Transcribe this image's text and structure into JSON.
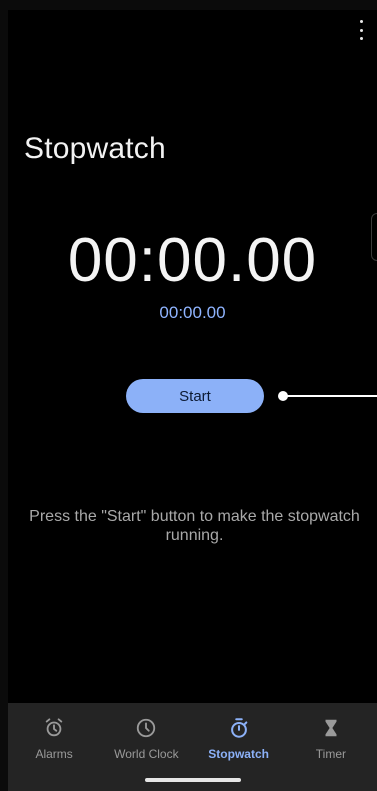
{
  "header": {
    "menu_icon": "more-vert-icon",
    "title": "Stopwatch"
  },
  "stopwatch": {
    "main_time": "00:00.00",
    "lap_time": "00:00.00",
    "start_label": "Start",
    "hint": "Press the \"Start\" button to make the stopwatch running."
  },
  "nav": {
    "items": [
      {
        "label": "Alarms",
        "icon": "alarm-icon",
        "active": false
      },
      {
        "label": "World Clock",
        "icon": "clock-icon",
        "active": false
      },
      {
        "label": "Stopwatch",
        "icon": "stopwatch-icon",
        "active": true
      },
      {
        "label": "Timer",
        "icon": "hourglass-icon",
        "active": false
      }
    ]
  },
  "colors": {
    "background": "#000000",
    "accent": "#8cb1f8",
    "nav_background": "#242424",
    "text_secondary": "#a9a9a9"
  }
}
